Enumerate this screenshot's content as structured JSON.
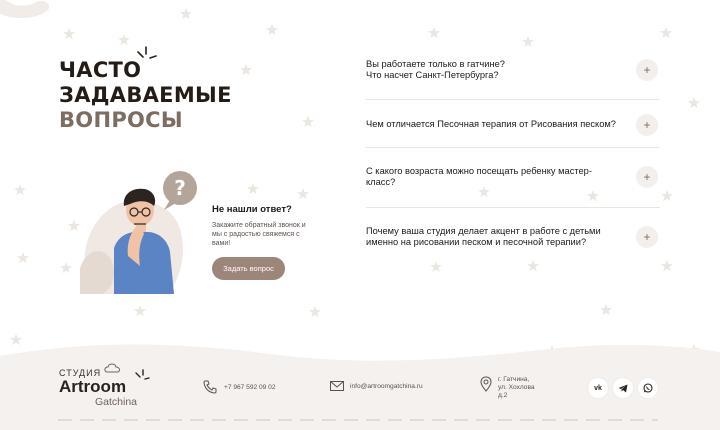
{
  "faq": {
    "title_line1": "ЧАСТО",
    "title_line2": "ЗАДАВАЕМЫЕ",
    "title_line3": "ВОПРОСЫ",
    "items": [
      {
        "line1": "Вы работаете только в гатчине?",
        "line2": "Что насчет Санкт-Петербурга?"
      },
      {
        "line1": "Чем отличается Песочная терапия от Рисования песком?",
        "line2": ""
      },
      {
        "line1": "С какого возраста можно посещать ребенку мастер-",
        "line2": "класс?"
      },
      {
        "line1": "Почему ваша студия делает акцент в работе с детьми",
        "line2": "именно на рисовании песком и песочной терапии?"
      }
    ],
    "expand_symbol": "+"
  },
  "ask": {
    "heading": "Не нашли ответ?",
    "text_line1": "Закажите обратный звонок и",
    "text_line2": "мы с радостью свяжемся с",
    "text_line3": "вами!",
    "button_label": "Задать вопрос",
    "bubble_symbol": "?"
  },
  "footer": {
    "logo_studio": "СТУДИЯ",
    "logo_brand": "Artroom",
    "logo_city": "Gatchina",
    "phone": "+7 967 592 09 02",
    "email": "info@artroomgatchina.ru",
    "address_line1": "г. Гатчина,",
    "address_line2": "ул. Хохлова",
    "address_line3": "д.2",
    "socials": [
      {
        "icon": "vk-icon",
        "label": "vk"
      },
      {
        "icon": "telegram-icon",
        "label": ""
      },
      {
        "icon": "whatsapp-icon",
        "label": ""
      }
    ]
  },
  "colors": {
    "accent_brown": "#9c8579",
    "title_muted": "#7d6c62",
    "footer_bg": "#f4f1ef",
    "star": "#ece6e1"
  }
}
